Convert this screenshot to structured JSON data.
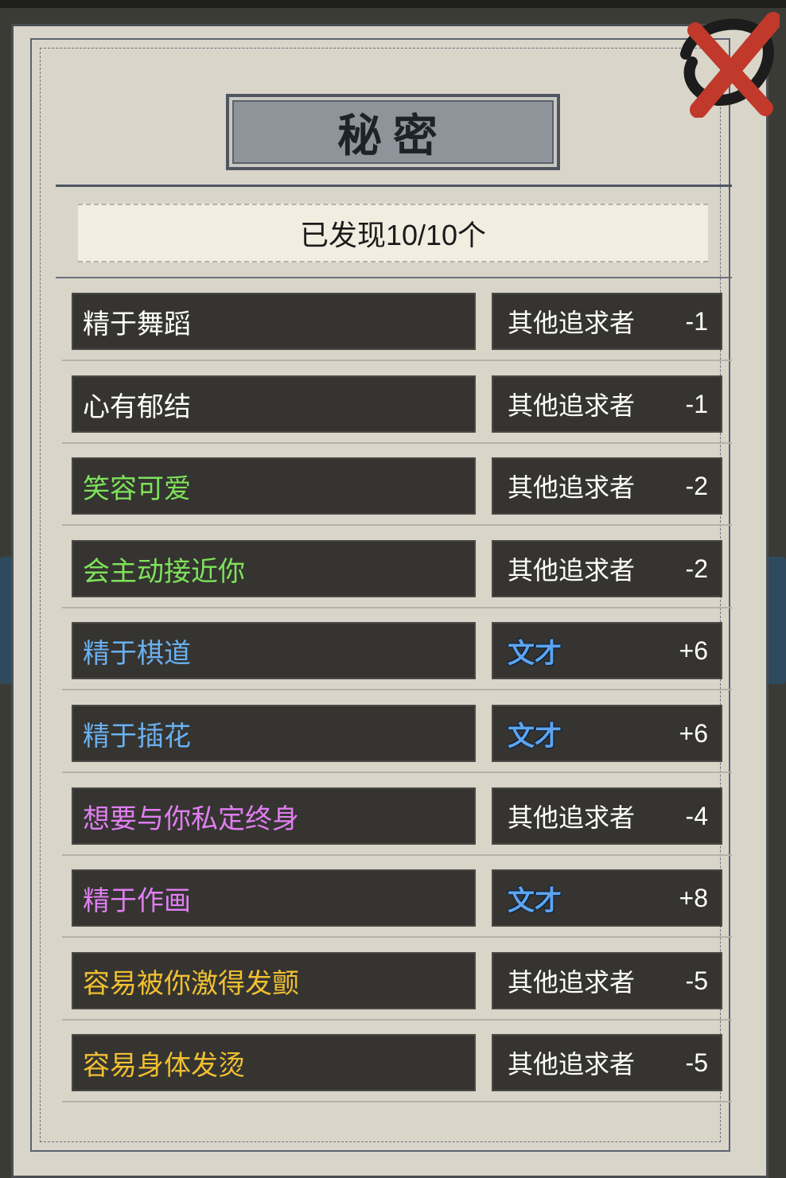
{
  "title": "秘密",
  "discovered_text": "已发现10/10个",
  "colors": {
    "white": "#ffffff",
    "green": "#7ee25a",
    "blue": "#6ab0f0",
    "purple": "#e07ef0",
    "gold": "#f0c030",
    "close_red": "#c0392b"
  },
  "secrets": [
    {
      "name": "精于舞蹈",
      "name_color": "#ffffff",
      "effect_label": "其他追求者",
      "effect_icon": "",
      "effect_value": "-1"
    },
    {
      "name": "心有郁结",
      "name_color": "#ffffff",
      "effect_label": "其他追求者",
      "effect_icon": "",
      "effect_value": "-1"
    },
    {
      "name": "笑容可爱",
      "name_color": "#7ee25a",
      "effect_label": "其他追求者",
      "effect_icon": "",
      "effect_value": "-2"
    },
    {
      "name": "会主动接近你",
      "name_color": "#7ee25a",
      "effect_label": "其他追求者",
      "effect_icon": "",
      "effect_value": "-2"
    },
    {
      "name": "精于棋道",
      "name_color": "#6ab0f0",
      "effect_label": "",
      "effect_icon": "文才",
      "effect_value": "+6"
    },
    {
      "name": "精于插花",
      "name_color": "#6ab0f0",
      "effect_label": "",
      "effect_icon": "文才",
      "effect_value": "+6"
    },
    {
      "name": "想要与你私定终身",
      "name_color": "#e07ef0",
      "effect_label": "其他追求者",
      "effect_icon": "",
      "effect_value": "-4"
    },
    {
      "name": "精于作画",
      "name_color": "#e07ef0",
      "effect_label": "",
      "effect_icon": "文才",
      "effect_value": "+8"
    },
    {
      "name": "容易被你激得发颤",
      "name_color": "#f0c030",
      "effect_label": "其他追求者",
      "effect_icon": "",
      "effect_value": "-5"
    },
    {
      "name": "容易身体发烫",
      "name_color": "#f0c030",
      "effect_label": "其他追求者",
      "effect_icon": "",
      "effect_value": "-5"
    }
  ],
  "icons": {
    "close": "close-brush-x-icon",
    "stat": "wencai-stat-icon"
  }
}
